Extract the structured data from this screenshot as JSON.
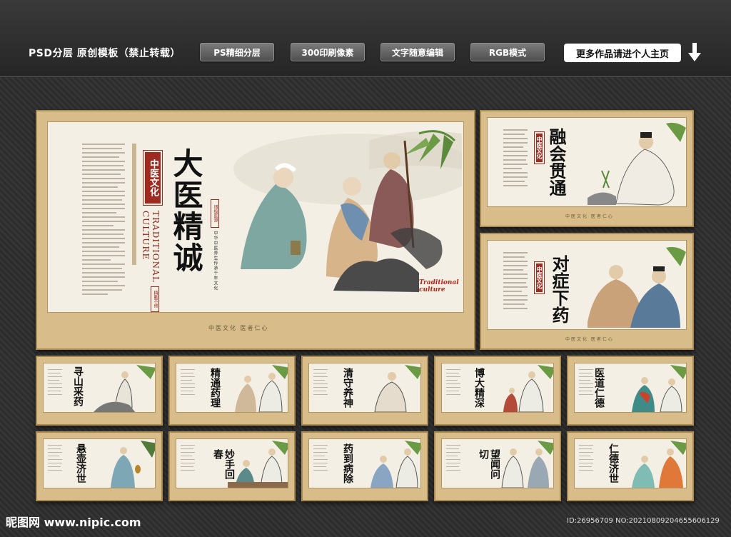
{
  "header": {
    "title": "PSD分层 原创模板（禁止转载）",
    "buttons": [
      "PS精细分层",
      "300印刷像素",
      "文字随意编辑",
      "RGB模式"
    ],
    "more_label": "更多作品请进个人主页"
  },
  "main_panel": {
    "tag": "中医文化",
    "title": "大医精诚",
    "english": "TRADITIONAL CULTURE",
    "seal_1": "博极医源",
    "seal_2": "精勤不倦",
    "sub_vertical": "中华中医养生传承千年文化",
    "corner_logo": "Traditional culture",
    "footer": "中医文化 医者仁心"
  },
  "side_panels": [
    {
      "tag": "中医文化",
      "title": "融会贯通",
      "footer": "中医文化 医者仁心"
    },
    {
      "tag": "中医文化",
      "title": "对症下药",
      "footer": "中医文化 医者仁心"
    }
  ],
  "small_panels": [
    {
      "title": "寻山采药"
    },
    {
      "title": "精通药理"
    },
    {
      "title": "清守养神"
    },
    {
      "title": "博大精深"
    },
    {
      "title": "医道仁德"
    },
    {
      "title": "悬壶济世"
    },
    {
      "title": "妙手回春"
    },
    {
      "title": "药到病除"
    },
    {
      "title": "望闻问切"
    },
    {
      "title": "仁德济世"
    }
  ],
  "watermark": {
    "logo": "昵图网 www.nipic.com",
    "id": "ID:26956709 NO:20210809204655606129"
  },
  "colors": {
    "frame": "#d8bd8b",
    "paper": "#f4efe4",
    "seal_red": "#9e2a20",
    "background": "#2f2f2f"
  }
}
